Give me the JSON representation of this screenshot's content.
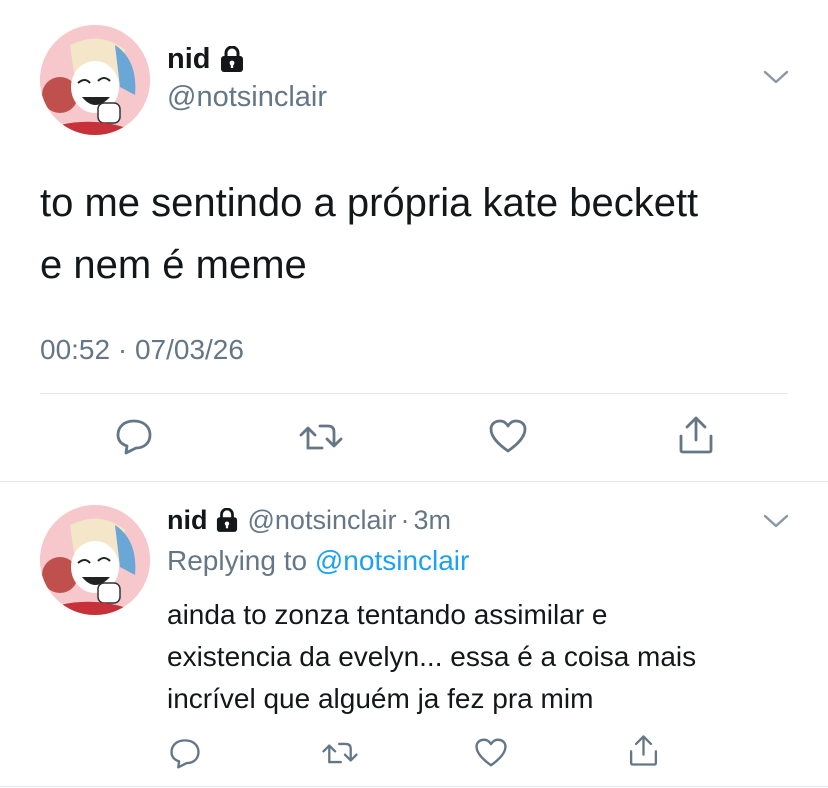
{
  "main_tweet": {
    "display_name": "nid",
    "handle": "@notsinclair",
    "text_line1": "to me sentindo a própria kate beckett",
    "text_line2": "e nem é meme",
    "timestamp": "00:52 · 07/03/26"
  },
  "reply_tweet": {
    "display_name": "nid",
    "handle": "@notsinclair",
    "time_sep": "·",
    "time": "3m",
    "replying_prefix": "Replying to",
    "replying_to": "@notsinclair",
    "text_line1": "ainda to zonza tentando assimilar e",
    "text_line2": "existencia da evelyn... essa é a coisa mais",
    "text_line3": "incrível que alguém ja fez pra mim"
  },
  "icons": {
    "lock": "lock-icon",
    "chevron": "chevron-down-icon",
    "reply": "comment-icon",
    "retweet": "retweet-icon",
    "like": "heart-icon",
    "share": "share-icon"
  },
  "colors": {
    "text": "#14171a",
    "secondary": "#657786",
    "link": "#1da1f2",
    "divider": "#e1e8ed"
  }
}
